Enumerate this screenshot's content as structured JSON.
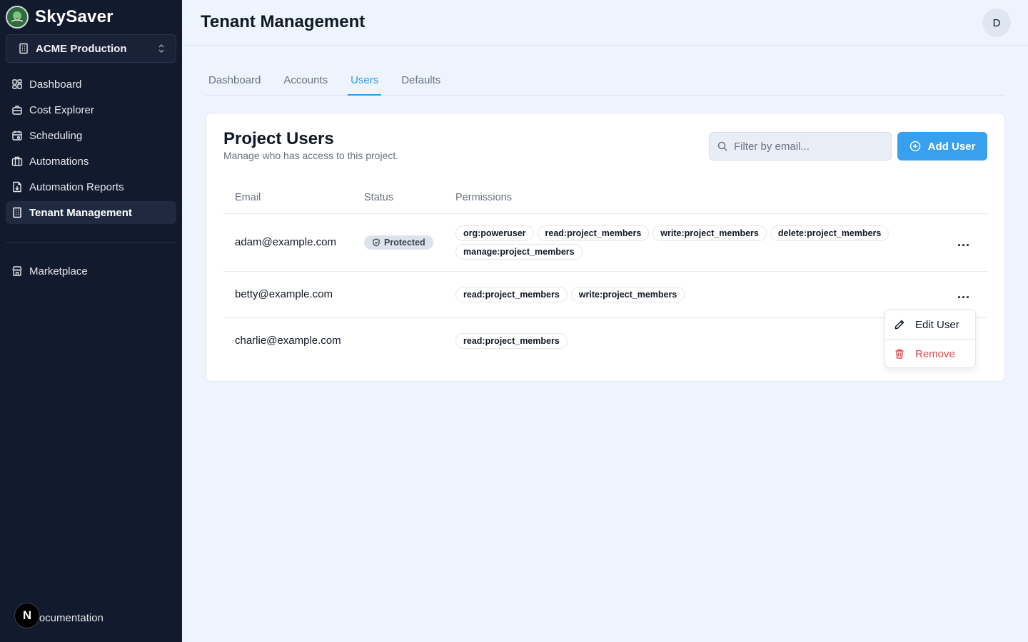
{
  "app": {
    "name": "SkySaver"
  },
  "tenant": {
    "current": "ACME Production"
  },
  "sidebar": {
    "items": [
      {
        "label": "Dashboard",
        "icon": "dashboard-icon"
      },
      {
        "label": "Cost Explorer",
        "icon": "cost-explorer-icon"
      },
      {
        "label": "Scheduling",
        "icon": "calendar-icon"
      },
      {
        "label": "Automations",
        "icon": "briefcase-icon"
      },
      {
        "label": "Automation Reports",
        "icon": "report-icon"
      },
      {
        "label": "Tenant Management",
        "icon": "building-icon",
        "active": true
      }
    ],
    "secondary": [
      {
        "label": "Marketplace",
        "icon": "store-icon"
      }
    ],
    "footer": {
      "doc_label": "Documentation",
      "badge": "N"
    }
  },
  "header": {
    "title": "Tenant Management",
    "avatar": "D"
  },
  "tabs": [
    {
      "label": "Dashboard"
    },
    {
      "label": "Accounts"
    },
    {
      "label": "Users",
      "active": true
    },
    {
      "label": "Defaults"
    }
  ],
  "card": {
    "title": "Project Users",
    "subtitle": "Manage who has access to this project.",
    "search_placeholder": "Filter by email...",
    "add_label": "Add User"
  },
  "table": {
    "headers": [
      "Email",
      "Status",
      "Permissions"
    ],
    "rows": [
      {
        "email": "adam@example.com",
        "status": "Protected",
        "permissions": [
          "org:poweruser",
          "read:project_members",
          "write:project_members",
          "delete:project_members",
          "manage:project_members"
        ]
      },
      {
        "email": "betty@example.com",
        "status": "",
        "permissions": [
          "read:project_members",
          "write:project_members"
        ]
      },
      {
        "email": "charlie@example.com",
        "status": "",
        "permissions": [
          "read:project_members"
        ]
      }
    ],
    "row_menu": "..."
  },
  "menu": {
    "edit_label": "Edit User",
    "remove_label": "Remove"
  },
  "colors": {
    "accent": "#37a1ef",
    "sidebar_bg": "#121a2e",
    "danger": "#e5484d"
  }
}
